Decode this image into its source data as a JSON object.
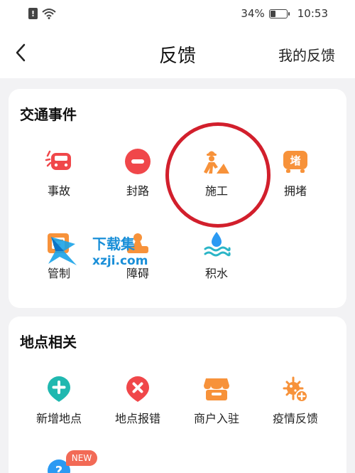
{
  "status_bar": {
    "battery_percent": "34%",
    "battery_level": 0.34,
    "time": "10:53"
  },
  "header": {
    "title": "反馈",
    "right_link": "我的反馈"
  },
  "traffic_section": {
    "title": "交通事件",
    "items": [
      {
        "label": "事故",
        "icon": "car-crash-icon"
      },
      {
        "label": "封路",
        "icon": "no-entry-icon"
      },
      {
        "label": "施工",
        "icon": "construction-worker-icon"
      },
      {
        "label": "拥堵",
        "icon": "congestion-icon"
      },
      {
        "label": "管制",
        "icon": "control-icon"
      },
      {
        "label": "障碍",
        "icon": "obstacle-icon"
      },
      {
        "label": "积水",
        "icon": "water-icon"
      }
    ]
  },
  "place_section": {
    "title": "地点相关",
    "items": [
      {
        "label": "新增地点",
        "icon": "add-location-icon"
      },
      {
        "label": "地点报错",
        "icon": "location-error-icon"
      },
      {
        "label": "商户入驻",
        "icon": "shop-icon"
      },
      {
        "label": "疫情反馈",
        "icon": "virus-icon"
      }
    ],
    "badge": "NEW"
  },
  "watermark": {
    "line1": "下载集",
    "line2": "xzji.com"
  },
  "colors": {
    "icon_red": "#f0474a",
    "icon_orange": "#f7923a",
    "icon_teal": "#20b8b0",
    "icon_blue": "#2b9af3",
    "highlight": "#d21f2c"
  }
}
